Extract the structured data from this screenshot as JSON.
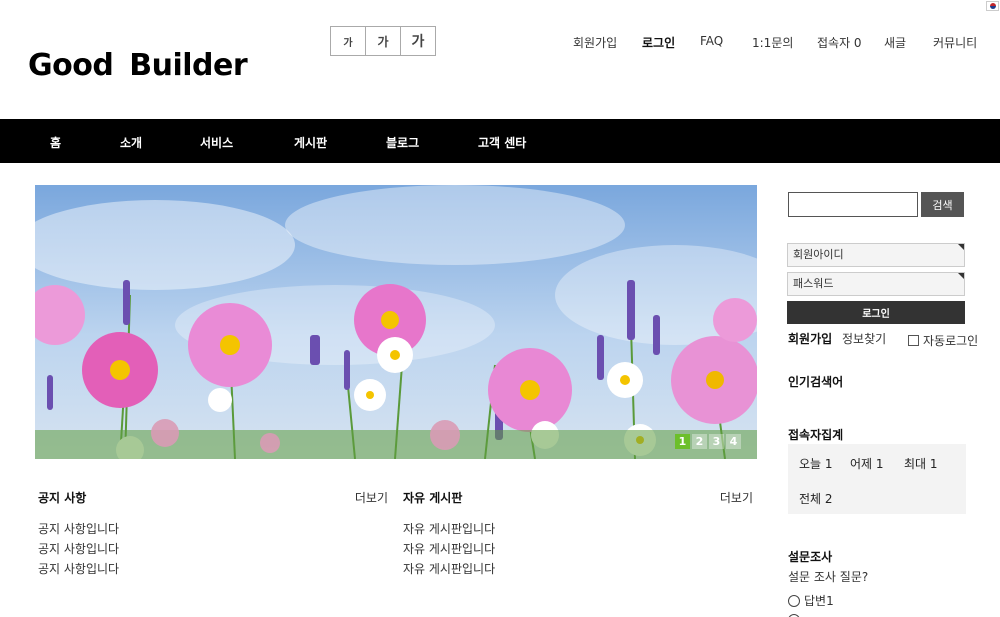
{
  "header": {
    "logo": "Good  Builder",
    "font_sizes": [
      "가",
      "가",
      "가"
    ],
    "top_menu": [
      "회원가입",
      "로그인",
      "FAQ",
      "1:1문의",
      "접속자 0",
      "새글",
      "커뮤니티"
    ]
  },
  "gnb": {
    "items": [
      "홈",
      "소개",
      "서비스",
      "게시판",
      "블로그",
      "고객 센타"
    ]
  },
  "banner": {
    "pages": [
      "1",
      "2",
      "3",
      "4"
    ],
    "active_page": "1"
  },
  "boards": [
    {
      "title": "공지 사항",
      "more": "더보기",
      "items": [
        "공지 사항입니다",
        "공지 사항입니다",
        "공지 사항입니다"
      ]
    },
    {
      "title": "자유 게시판",
      "more": "더보기",
      "items": [
        "자유 게시판입니다",
        "자유 게시판입니다",
        "자유 게시판입니다"
      ]
    }
  ],
  "sidebar": {
    "search_value": "",
    "search_button": "검색",
    "login": {
      "id_placeholder": "회원아이디",
      "pw_placeholder": "패스워드",
      "button": "로그인",
      "join": "회원가입",
      "find": "정보찾기",
      "auto": "자동로그인"
    },
    "popular_title": "인기검색어",
    "visit": {
      "title": "접속자집계",
      "today": "오늘 1",
      "yesterday": "어제 1",
      "max": "최대 1",
      "total": "전체 2"
    },
    "poll": {
      "title": "설문조사",
      "question": "설문 조사 질문?",
      "option1": "답변1"
    }
  },
  "colors": {
    "gnb_bg": "#000000",
    "pager_active": "#6cbf2b",
    "button_dark": "#333333"
  }
}
